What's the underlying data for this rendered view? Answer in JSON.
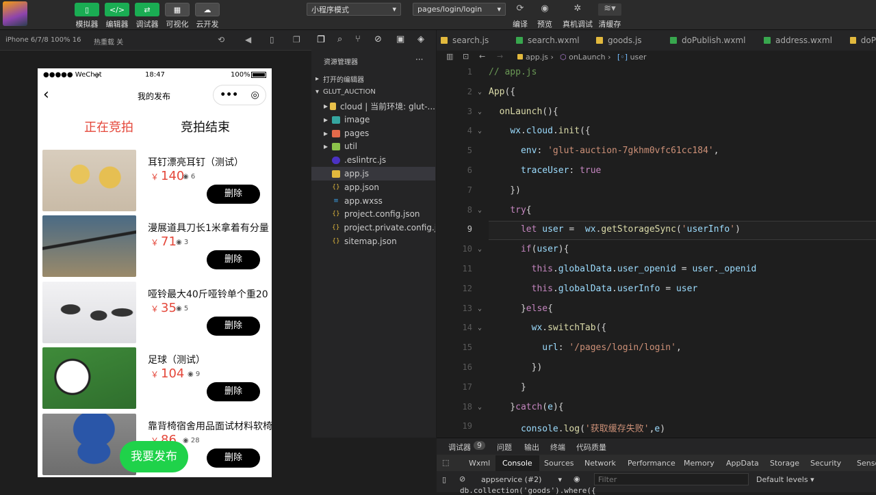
{
  "toolbar": {
    "buttons": [
      {
        "label": "模拟器",
        "icon": "phone-icon"
      },
      {
        "label": "编辑器",
        "icon": "code-icon"
      },
      {
        "label": "调试器",
        "icon": "debug-icon"
      },
      {
        "label": "可视化",
        "icon": "grid-icon"
      },
      {
        "label": "云开发",
        "icon": "cloud-icon"
      }
    ],
    "mode_select": "小程序模式",
    "page_select": "pages/login/login",
    "right_buttons": [
      "编译",
      "预览",
      "真机调试",
      "清缓存"
    ]
  },
  "simulator": {
    "device": "iPhone 6/7/8 100% 16",
    "hot_reload": "热重载 关",
    "status": {
      "carrier": "●●●●● WeChat",
      "time": "18:47",
      "battery": "100%"
    },
    "nav_title": "我的发布",
    "tabs": [
      "正在竞拍",
      "竞拍结束"
    ],
    "active_tab": 0,
    "items": [
      {
        "title": "耳钉漂亮耳钉（测试）",
        "currency": "￥",
        "price": "140",
        "views": "6",
        "delete": "删除"
      },
      {
        "title": "漫展道具刀长1米拿着有分量",
        "currency": "￥",
        "price": "71",
        "views": "3",
        "delete": "删除"
      },
      {
        "title": "哑铃最大40斤哑铃单个重20",
        "currency": "￥",
        "price": "35",
        "views": "5",
        "delete": "删除"
      },
      {
        "title": "足球（测试）",
        "currency": "￥",
        "price": "104",
        "views": "9",
        "delete": "删除"
      },
      {
        "title": "靠背椅宿舍用品面试材料软椅",
        "currency": "￥",
        "price": "86",
        "views": "28",
        "delete": "删除"
      }
    ],
    "fab": "我要发布"
  },
  "explorer": {
    "title": "资源管理器",
    "open_editors": "打开的编辑器",
    "project": "GLUT_AUCTION",
    "tree": [
      {
        "name": "cloud | 当前环境: glut-...",
        "type": "folder"
      },
      {
        "name": "image",
        "type": "folder"
      },
      {
        "name": "pages",
        "type": "folder"
      },
      {
        "name": "util",
        "type": "folder"
      },
      {
        "name": ".eslintrc.js",
        "type": "eslint"
      },
      {
        "name": "app.js",
        "type": "js"
      },
      {
        "name": "app.json",
        "type": "json"
      },
      {
        "name": "app.wxss",
        "type": "wxss"
      },
      {
        "name": "project.config.json",
        "type": "json"
      },
      {
        "name": "project.private.config.js...",
        "type": "json"
      },
      {
        "name": "sitemap.json",
        "type": "json"
      }
    ]
  },
  "editor": {
    "tabs": [
      "search.js",
      "search.wxml",
      "goods.js",
      "doPublish.wxml",
      "address.wxml",
      "doP"
    ],
    "breadcrumb": [
      "app.js",
      "onLaunch",
      "user"
    ],
    "lines": [
      {
        "n": "1",
        "text": "// app.js"
      },
      {
        "n": "2",
        "text": "App({"
      },
      {
        "n": "3",
        "text": "  onLaunch(){"
      },
      {
        "n": "4",
        "text": "    wx.cloud.init({"
      },
      {
        "n": "5",
        "text": "      env: 'glut-auction-7gkhm0vfc61cc184',"
      },
      {
        "n": "6",
        "text": "      traceUser: true"
      },
      {
        "n": "7",
        "text": "    })"
      },
      {
        "n": "8",
        "text": "    try{"
      },
      {
        "n": "9",
        "text": "      let user =  wx.getStorageSync('userInfo')"
      },
      {
        "n": "10",
        "text": "      if(user){"
      },
      {
        "n": "11",
        "text": "        this.globalData.user_openid = user._openid"
      },
      {
        "n": "12",
        "text": "        this.globalData.userInfo = user"
      },
      {
        "n": "13",
        "text": "      }else{"
      },
      {
        "n": "14",
        "text": "        wx.switchTab({"
      },
      {
        "n": "15",
        "text": "          url: '/pages/login/login',"
      },
      {
        "n": "16",
        "text": "        })"
      },
      {
        "n": "17",
        "text": "      }"
      },
      {
        "n": "18",
        "text": "    }catch(e){"
      },
      {
        "n": "19",
        "text": "      console.log('获取缓存失败',e)"
      }
    ]
  },
  "devtools": {
    "top_tabs": [
      "调试器",
      "问题",
      "输出",
      "终端",
      "代码质量"
    ],
    "badge": "9",
    "tabs": [
      "Wxml",
      "Console",
      "Sources",
      "Network",
      "Performance",
      "Memory",
      "AppData",
      "Storage",
      "Security",
      "Sensor"
    ],
    "active": "Console",
    "context": "appservice (#2)",
    "filter_placeholder": "Filter",
    "levels": "Default levels",
    "log": "db.collection('goods').where({"
  },
  "colors": {
    "accent_green": "#1aad53",
    "price_red": "#e4473a",
    "tab_active": "#e4473a"
  }
}
